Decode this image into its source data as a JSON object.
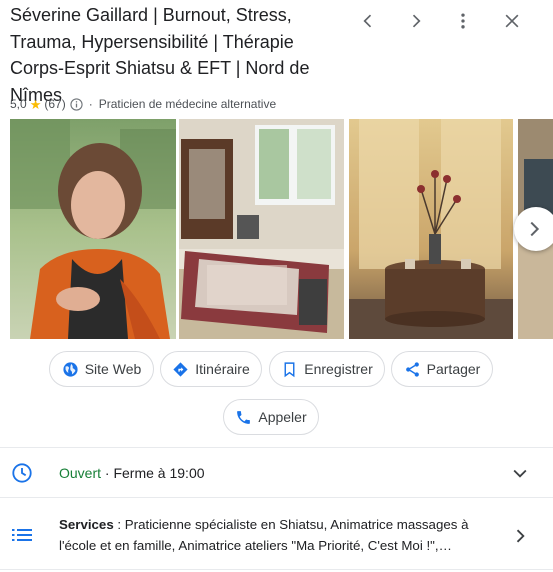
{
  "business": {
    "name": "Séverine Gaillard | Burnout, Stress, Trauma, Hypersensibilité | Thérapie Corps-Esprit Shiatsu & EFT | Nord de Nîmes",
    "rating": "5,0",
    "review_count": "(67)",
    "separator": "·",
    "category": "Praticien de médecine alternative"
  },
  "header_controls": {
    "icons": [
      "chevron-left-icon",
      "chevron-right-icon",
      "more-vert-icon",
      "close-icon"
    ]
  },
  "photos": {
    "items": [
      "portrait-photo",
      "treatment-room-photo",
      "interior-table-photo",
      "partial-photo"
    ],
    "next_icon": "chevron-right-icon"
  },
  "actions": {
    "website": "Site Web",
    "directions": "Itinéraire",
    "save": "Enregistrer",
    "share": "Partager",
    "call": "Appeler"
  },
  "hours": {
    "status": "Ouvert",
    "separator": " · ",
    "closes": "Ferme à 19:00",
    "status_color": "#188038"
  },
  "services": {
    "label": "Services",
    "text": " : Praticienne spécialiste en Shiatsu, Animatrice massages à l'école et en famille, Animatrice ateliers \"Ma Priorité, C'est Moi !\",…"
  },
  "colors": {
    "accent_blue": "#1a73e8",
    "star": "#fbbc04",
    "text": "#202124",
    "muted": "#4d5156"
  }
}
